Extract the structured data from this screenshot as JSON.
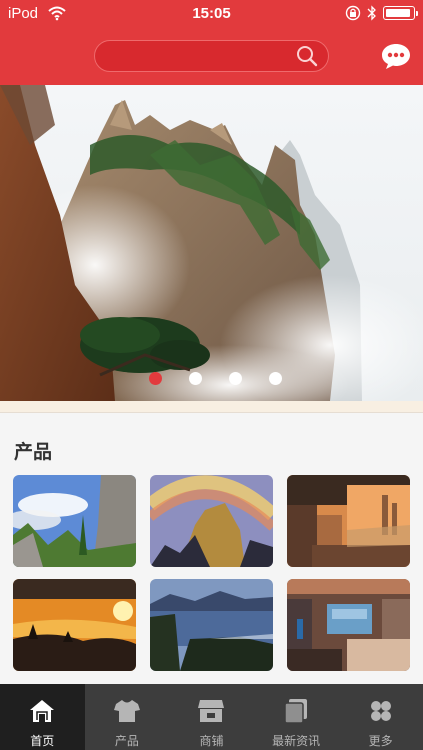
{
  "status_bar": {
    "carrier": "iPod",
    "time": "15:05",
    "battery_level": 0.92
  },
  "search": {
    "value": "",
    "placeholder": ""
  },
  "banner": {
    "slide_count": 4,
    "active_slide": 1
  },
  "products": {
    "title": "产品",
    "items": [
      {
        "scene": "mountain-peaks-blue-sky"
      },
      {
        "scene": "rainbow-over-cliff"
      },
      {
        "scene": "balcony-city-view"
      },
      {
        "scene": "sunset-over-hills"
      },
      {
        "scene": "coastal-bay"
      },
      {
        "scene": "hotel-room"
      }
    ]
  },
  "tabbar": {
    "items": [
      {
        "label": "首页",
        "icon": "home-icon",
        "active": true
      },
      {
        "label": "产品",
        "icon": "shirt-icon",
        "active": false
      },
      {
        "label": "商铺",
        "icon": "shop-icon",
        "active": false
      },
      {
        "label": "最新资讯",
        "icon": "news-icon",
        "active": false
      },
      {
        "label": "更多",
        "icon": "more-icon",
        "active": false
      }
    ]
  },
  "colors": {
    "brand": "#e23a3d",
    "tabbar_bg": "#3d3d3d",
    "tabbar_active_bg": "#1f1f1f"
  }
}
